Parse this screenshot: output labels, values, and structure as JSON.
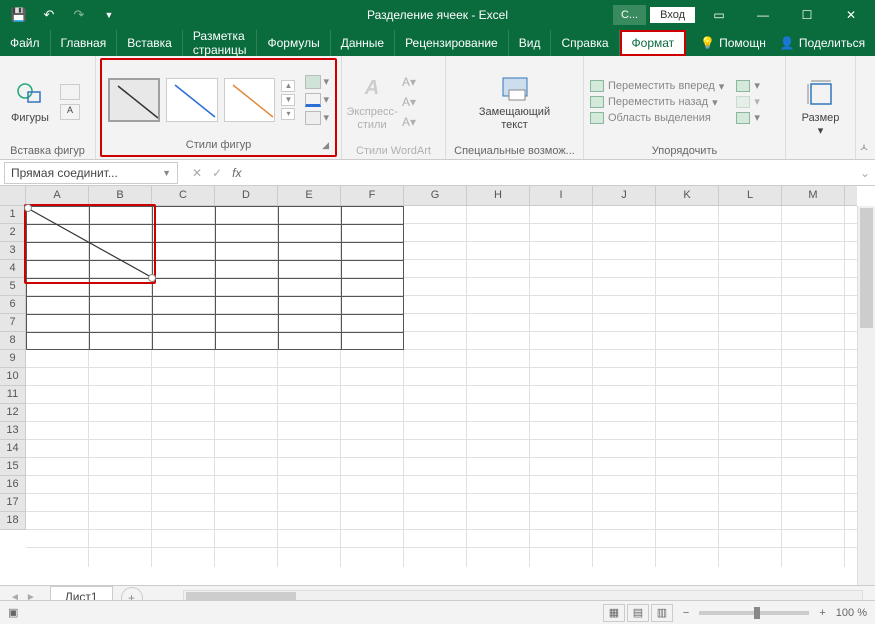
{
  "titlebar": {
    "doc_title": "Разделение ячеек  -  Excel",
    "context_label": "С...",
    "login": "Вход"
  },
  "menu": {
    "tabs": [
      "Файл",
      "Главная",
      "Вставка",
      "Разметка страницы",
      "Формулы",
      "Данные",
      "Рецензирование",
      "Вид",
      "Справка",
      "Формат"
    ],
    "active_index": 9,
    "help": "Помощн",
    "share": "Поделиться"
  },
  "ribbon": {
    "insert_shapes": {
      "button": "Фигуры",
      "group": "Вставка фигур"
    },
    "shape_styles": {
      "group": "Стили фигур"
    },
    "wordart": {
      "button": "Экспресс-стили",
      "group": "Стили WordArt"
    },
    "alt_text": {
      "button": "Замещающий текст",
      "group": "Специальные возмож..."
    },
    "arrange": {
      "forward": "Переместить вперед",
      "backward": "Переместить назад",
      "selection": "Область выделения",
      "group": "Упорядочить"
    },
    "size": {
      "button": "Размер",
      "group": ""
    }
  },
  "namebox": {
    "value": "Прямая соединит..."
  },
  "sheet": {
    "columns": [
      "A",
      "B",
      "C",
      "D",
      "E",
      "F",
      "G",
      "H",
      "I",
      "J",
      "K",
      "L",
      "M"
    ],
    "rows": [
      1,
      2,
      3,
      4,
      5,
      6,
      7,
      8,
      9,
      10,
      11,
      12,
      13,
      14,
      15,
      16,
      17,
      18
    ],
    "tab": "Лист1"
  },
  "status": {
    "zoom": "100 %"
  },
  "colors": {
    "brand": "#0a6b3d",
    "highlight": "#c00"
  }
}
